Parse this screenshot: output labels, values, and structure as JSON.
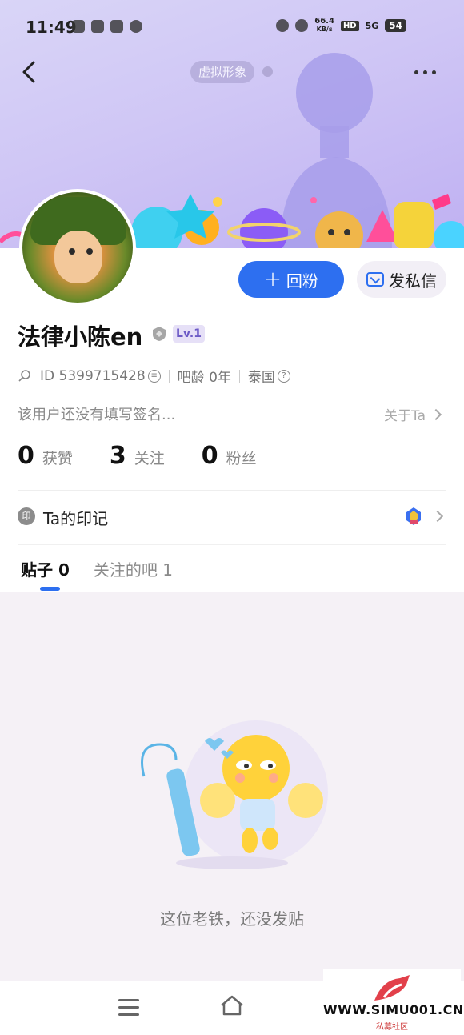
{
  "status_bar": {
    "time": "11:49",
    "network_speed": "66.4",
    "network_unit": "KB/s",
    "hd_label": "HD",
    "signal_label": "5G",
    "battery": "54"
  },
  "header": {
    "virtual_avatar_label": "虚拟形象"
  },
  "profile": {
    "username": "法律小陈en",
    "level": "Lv.1",
    "id_text": "ID 5399715428",
    "bar_age": "吧龄 0年",
    "location": "泰国",
    "bio": "该用户还没有填写签名...",
    "about_label": "关于Ta"
  },
  "actions": {
    "follow_back_label": "回粉",
    "message_label": "发私信"
  },
  "stats": [
    {
      "value": "0",
      "label": "获赞"
    },
    {
      "value": "3",
      "label": "关注"
    },
    {
      "value": "0",
      "label": "粉丝"
    }
  ],
  "marks": {
    "icon_text": "印",
    "label": "Ta的印记"
  },
  "tabs": [
    {
      "label": "贴子 0",
      "active": true
    },
    {
      "label": "关注的吧 1",
      "active": false
    }
  ],
  "empty_state": {
    "message": "这位老铁，还没发贴"
  },
  "watermark": {
    "url": "WWW.SIMU001.CN",
    "subtitle": "私募社区"
  },
  "colors": {
    "accent": "#2d6ff0",
    "banner": "#cfc6f5",
    "background": "#f5f1f6"
  }
}
